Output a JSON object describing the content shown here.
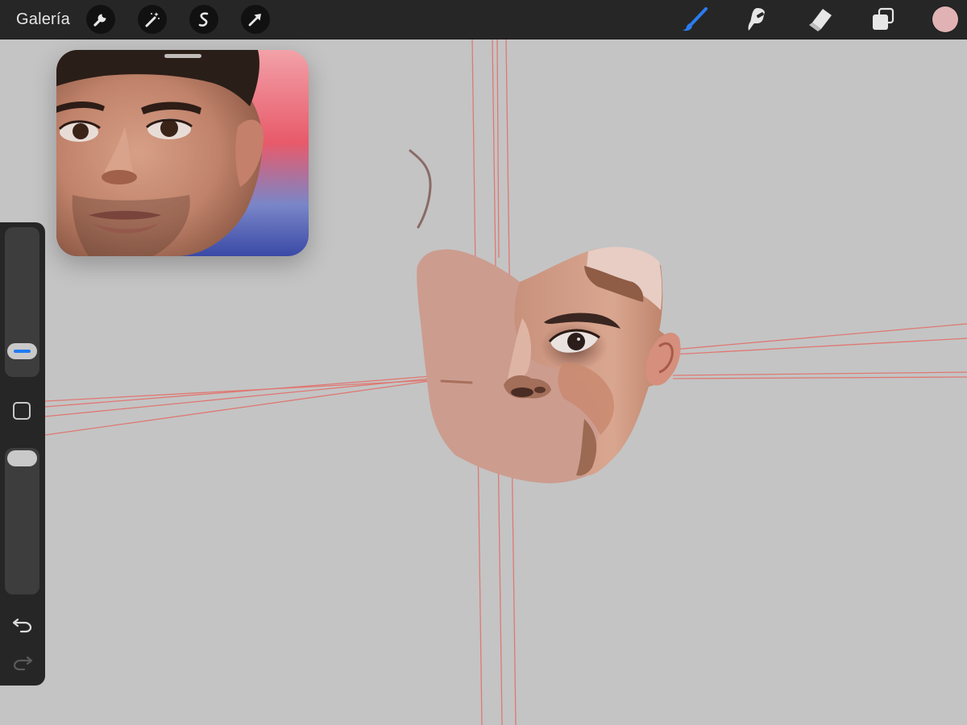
{
  "toolbar": {
    "gallery_label": "Galería",
    "left_tools": [
      {
        "icon": "wrench-icon"
      },
      {
        "icon": "magic-wand-icon"
      },
      {
        "icon": "selection-icon"
      },
      {
        "icon": "move-arrow-icon"
      }
    ],
    "right_tools": [
      {
        "icon": "paintbrush-icon",
        "active": true
      },
      {
        "icon": "smudge-icon"
      },
      {
        "icon": "eraser-icon"
      },
      {
        "icon": "layers-icon"
      }
    ],
    "active_color": "#e0b2b3",
    "active_tool_color": "#2a7cf0"
  },
  "sidebar": {
    "size_slider_value": 0.12,
    "opacity_slider_value": 1.0,
    "modify_button_icon": "square-icon",
    "undo_icon": "undo-icon",
    "redo_icon": "redo-icon"
  },
  "colors": {
    "canvas": "#c4c4c4",
    "toolbar": "#262626",
    "guide_lines": "#e2706a",
    "skin_base": "#cc9c8f"
  }
}
